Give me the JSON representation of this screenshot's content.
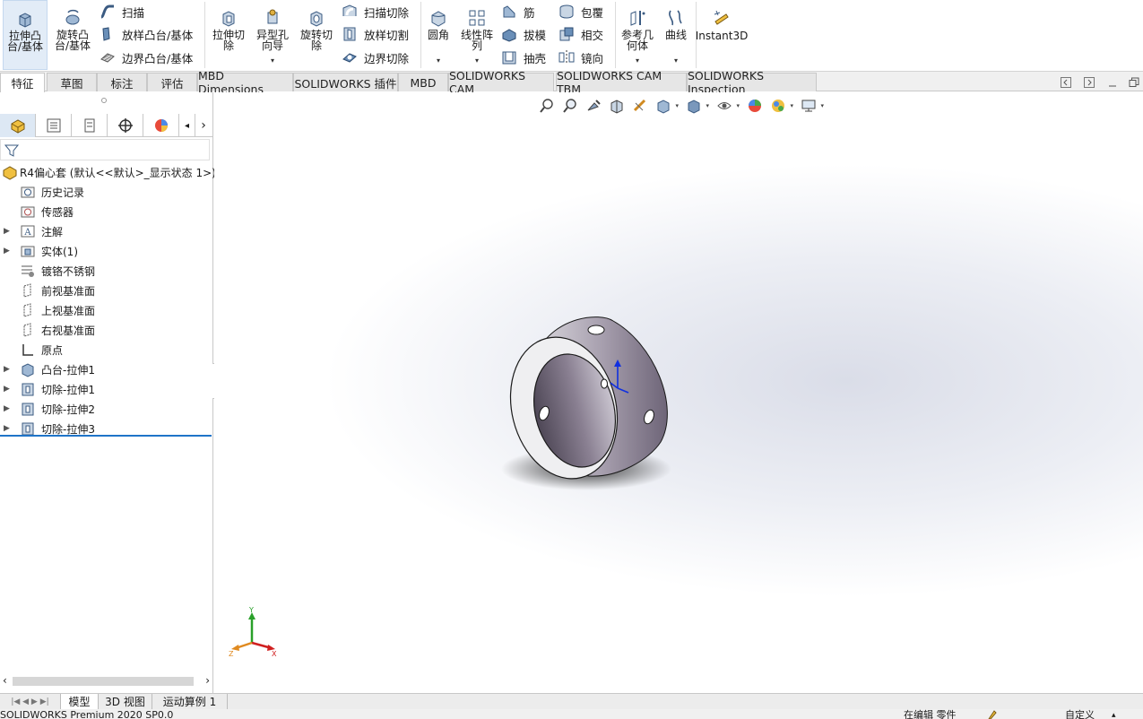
{
  "ribbon": {
    "extrude_boss": "拉伸凸台/基体",
    "revolve_boss": "旋转凸台/基体",
    "sweep": "扫描",
    "loft_boss": "放样凸台/基体",
    "boundary_boss": "边界凸台/基体",
    "extrude_cut": "拉伸切除",
    "hole_wizard": "异型孔向导",
    "revolve_cut": "旋转切除",
    "sweep_cut": "扫描切除",
    "loft_cut": "放样切割",
    "boundary_cut": "边界切除",
    "fillet": "圆角",
    "linear_pattern": "线性阵列",
    "rib": "筋",
    "draft": "拔模",
    "shell": "抽壳",
    "wrap": "包覆",
    "intersect": "相交",
    "mirror": "镜向",
    "ref_geometry": "参考几何体",
    "curves": "曲线",
    "instant3d": "Instant3D"
  },
  "tabs": [
    "特征",
    "草图",
    "标注",
    "评估",
    "MBD Dimensions",
    "SOLIDWORKS 插件",
    "MBD",
    "SOLIDWORKS CAM",
    "SOLIDWORKS CAM TBM",
    "SOLIDWORKS Inspection"
  ],
  "tree": {
    "root": "R4偏心套  (默认<<默认>_显示状态 1>)",
    "items": [
      "历史记录",
      "传感器",
      "注解",
      "实体(1)",
      "镀铬不锈钢",
      "前视基准面",
      "上视基准面",
      "右视基准面",
      "原点",
      "凸台-拉伸1",
      "切除-拉伸1",
      "切除-拉伸2",
      "切除-拉伸3"
    ]
  },
  "triad": {
    "x": "X",
    "y": "Y",
    "z": "Z"
  },
  "bottom_tabs": [
    "模型",
    "3D 视图",
    "运动算例 1"
  ],
  "status": {
    "left": "SOLIDWORKS Premium 2020 SP0.0",
    "editing": "在编辑 零件",
    "custom": "自定义"
  },
  "colors": {
    "accent": "#1f74c8",
    "active_tab_bg": "#e2ecf7",
    "part_body": "#8a7f90"
  }
}
